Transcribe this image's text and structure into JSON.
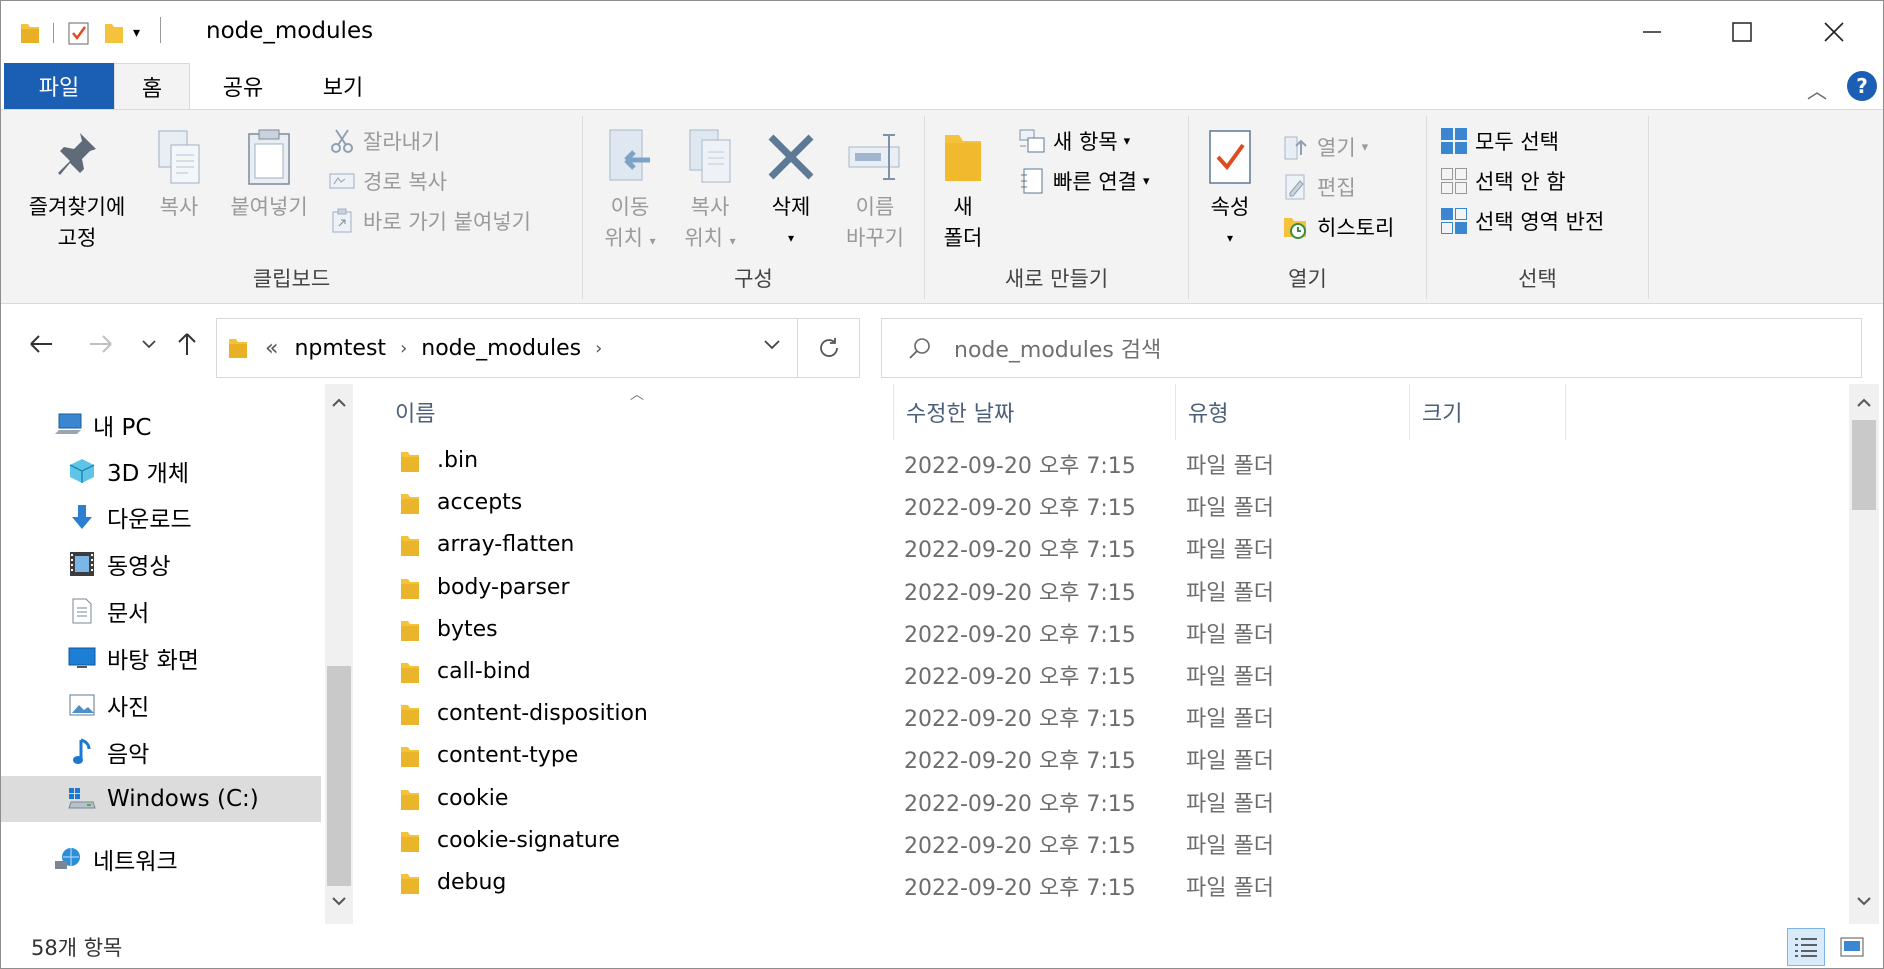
{
  "window": {
    "title": "node_modules"
  },
  "ribbon_tabs": [
    {
      "label": "파일"
    },
    {
      "label": "홈"
    },
    {
      "label": "공유"
    },
    {
      "label": "보기"
    }
  ],
  "ribbon": {
    "clipboard": {
      "label": "클립보드",
      "pin_line1": "즐겨찾기에",
      "pin_line2": "고정",
      "copy": "복사",
      "paste": "붙여넣기",
      "cut": "잘라내기",
      "copy_path": "경로 복사",
      "paste_shortcut": "바로 가기 붙여넣기"
    },
    "organize": {
      "label": "구성",
      "move_line1": "이동",
      "move_line2": "위치",
      "copyto_line1": "복사",
      "copyto_line2": "위치",
      "delete": "삭제",
      "rename_line1": "이름",
      "rename_line2": "바꾸기"
    },
    "new": {
      "label": "새로 만들기",
      "new_folder_line1": "새",
      "new_folder_line2": "폴더",
      "new_item": "새 항목",
      "easy_access": "빠른 연결"
    },
    "open": {
      "label": "열기",
      "properties": "속성",
      "open": "열기",
      "edit": "편집",
      "history": "히스토리"
    },
    "select": {
      "label": "선택",
      "select_all": "모두 선택",
      "select_none": "선택 안 함",
      "invert": "선택 영역 반전"
    }
  },
  "address": {
    "overflow": "«",
    "crumbs": [
      "npmtest",
      "node_modules"
    ],
    "search_placeholder": "node_modules 검색"
  },
  "nav_tree": [
    {
      "label": "내 PC",
      "icon": "pc-icon"
    },
    {
      "label": "3D 개체",
      "icon": "3d-objects-icon"
    },
    {
      "label": "다운로드",
      "icon": "download-icon"
    },
    {
      "label": "동영상",
      "icon": "video-icon"
    },
    {
      "label": "문서",
      "icon": "document-icon"
    },
    {
      "label": "바탕 화면",
      "icon": "desktop-icon"
    },
    {
      "label": "사진",
      "icon": "pictures-icon"
    },
    {
      "label": "음악",
      "icon": "music-icon"
    },
    {
      "label": "Windows (C:)",
      "icon": "drive-icon",
      "selected": true
    },
    {
      "label": "네트워크",
      "icon": "network-icon"
    }
  ],
  "columns": {
    "name": "이름",
    "modified": "수정한 날짜",
    "type": "유형",
    "size": "크기"
  },
  "files": [
    {
      "name": ".bin",
      "modified": "2022-09-20 오후 7:15",
      "type": "파일 폴더"
    },
    {
      "name": "accepts",
      "modified": "2022-09-20 오후 7:15",
      "type": "파일 폴더"
    },
    {
      "name": "array-flatten",
      "modified": "2022-09-20 오후 7:15",
      "type": "파일 폴더"
    },
    {
      "name": "body-parser",
      "modified": "2022-09-20 오후 7:15",
      "type": "파일 폴더"
    },
    {
      "name": "bytes",
      "modified": "2022-09-20 오후 7:15",
      "type": "파일 폴더"
    },
    {
      "name": "call-bind",
      "modified": "2022-09-20 오후 7:15",
      "type": "파일 폴더"
    },
    {
      "name": "content-disposition",
      "modified": "2022-09-20 오후 7:15",
      "type": "파일 폴더"
    },
    {
      "name": "content-type",
      "modified": "2022-09-20 오후 7:15",
      "type": "파일 폴더"
    },
    {
      "name": "cookie",
      "modified": "2022-09-20 오후 7:15",
      "type": "파일 폴더"
    },
    {
      "name": "cookie-signature",
      "modified": "2022-09-20 오후 7:15",
      "type": "파일 폴더"
    },
    {
      "name": "debug",
      "modified": "2022-09-20 오후 7:15",
      "type": "파일 폴더"
    }
  ],
  "status": {
    "item_count": "58개 항목"
  },
  "colors": {
    "file_tab": "#1a5fb4",
    "folder": "#f5c33b",
    "selection": "#dcdcdc",
    "header_text": "#4c607a"
  }
}
